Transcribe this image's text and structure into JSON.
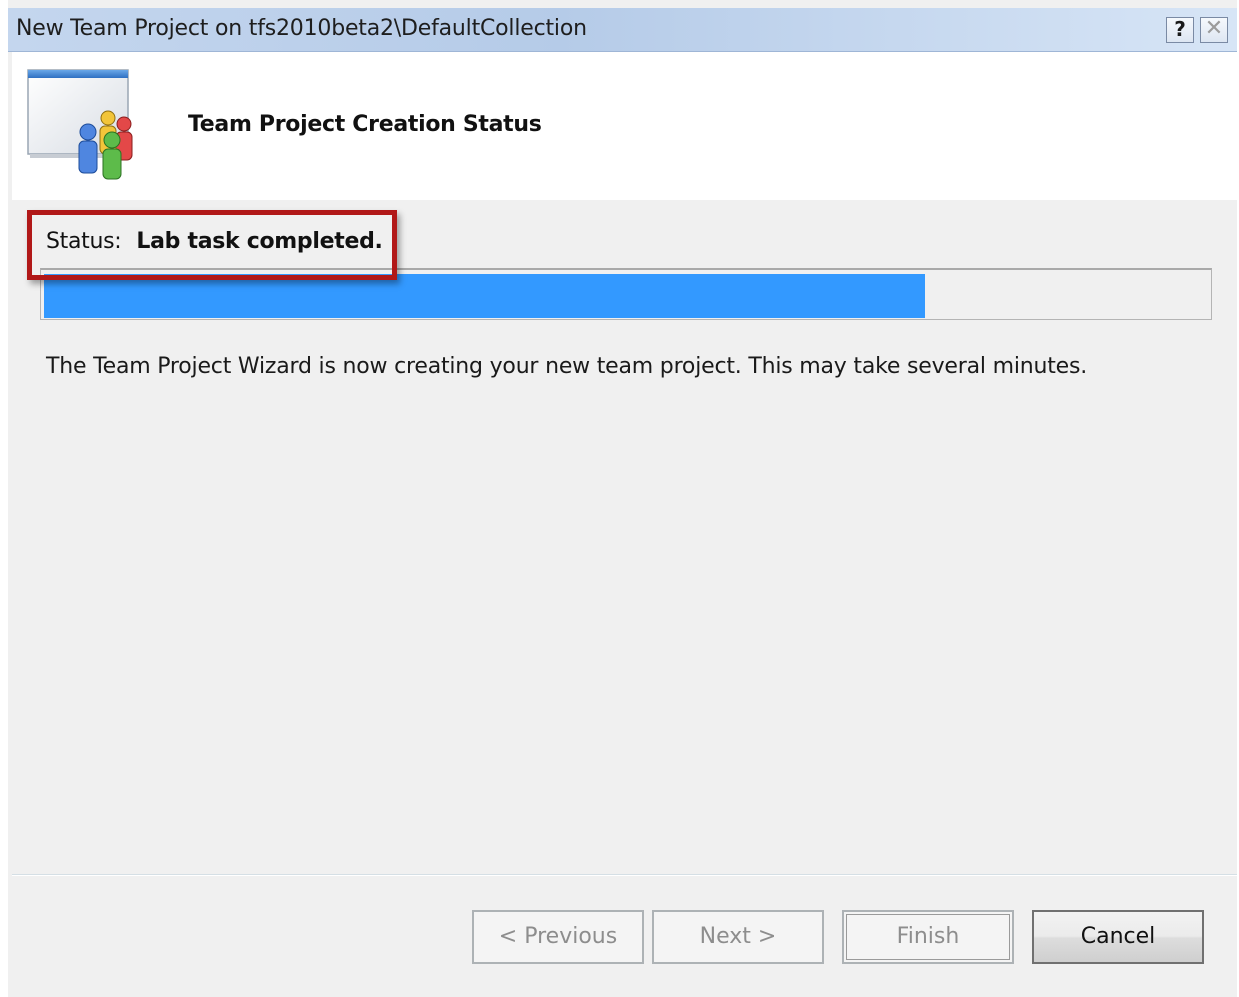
{
  "window": {
    "title": "New Team Project on tfs2010beta2\\DefaultCollection",
    "help_button": "?",
    "close_button": "✕"
  },
  "header": {
    "title": "Team Project Creation Status",
    "icon": "team-project-icon"
  },
  "status": {
    "label": "Status:",
    "value": "Lab task completed."
  },
  "progress": {
    "fraction": 0.757
  },
  "message": "The Team Project Wizard is now creating your new team project.  This may take several minutes.",
  "buttons": {
    "previous": "< Previous",
    "next": "Next >",
    "finish": "Finish",
    "cancel": "Cancel"
  },
  "colors": {
    "progress_fill": "#3399ff",
    "highlight_border": "#b11818"
  }
}
